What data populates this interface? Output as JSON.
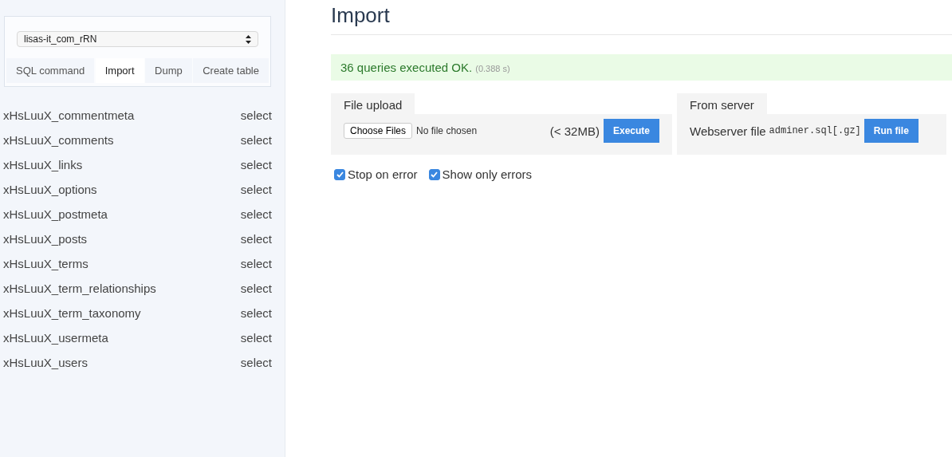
{
  "sidebar": {
    "database_select": {
      "value": "lisas-it_com_rRN"
    },
    "tabs": [
      {
        "label": "SQL command",
        "selected": false
      },
      {
        "label": "Import",
        "selected": true
      },
      {
        "label": "Dump",
        "selected": false
      },
      {
        "label": "Create table",
        "selected": false
      }
    ],
    "tables": [
      {
        "name": "xHsLuuX_commentmeta",
        "action": "select"
      },
      {
        "name": "xHsLuuX_comments",
        "action": "select"
      },
      {
        "name": "xHsLuuX_links",
        "action": "select"
      },
      {
        "name": "xHsLuuX_options",
        "action": "select"
      },
      {
        "name": "xHsLuuX_postmeta",
        "action": "select"
      },
      {
        "name": "xHsLuuX_posts",
        "action": "select"
      },
      {
        "name": "xHsLuuX_terms",
        "action": "select"
      },
      {
        "name": "xHsLuuX_term_relationships",
        "action": "select"
      },
      {
        "name": "xHsLuuX_term_taxonomy",
        "action": "select"
      },
      {
        "name": "xHsLuuX_usermeta",
        "action": "select"
      },
      {
        "name": "xHsLuuX_users",
        "action": "select"
      }
    ]
  },
  "main": {
    "title": "Import",
    "message": {
      "text": "36 queries executed OK.",
      "time": "(0.388 s)"
    },
    "file_upload": {
      "legend": "File upload",
      "choose_button": "Choose Files",
      "file_status": "No file chosen",
      "limit": "(< 32MB)",
      "execute_button": "Execute"
    },
    "from_server": {
      "legend": "From server",
      "label": "Webserver file",
      "filename": "adminer.sql[.gz]",
      "run_button": "Run file"
    },
    "options": [
      {
        "label": "Stop on error",
        "checked": true
      },
      {
        "label": "Show only errors",
        "checked": true
      }
    ]
  }
}
